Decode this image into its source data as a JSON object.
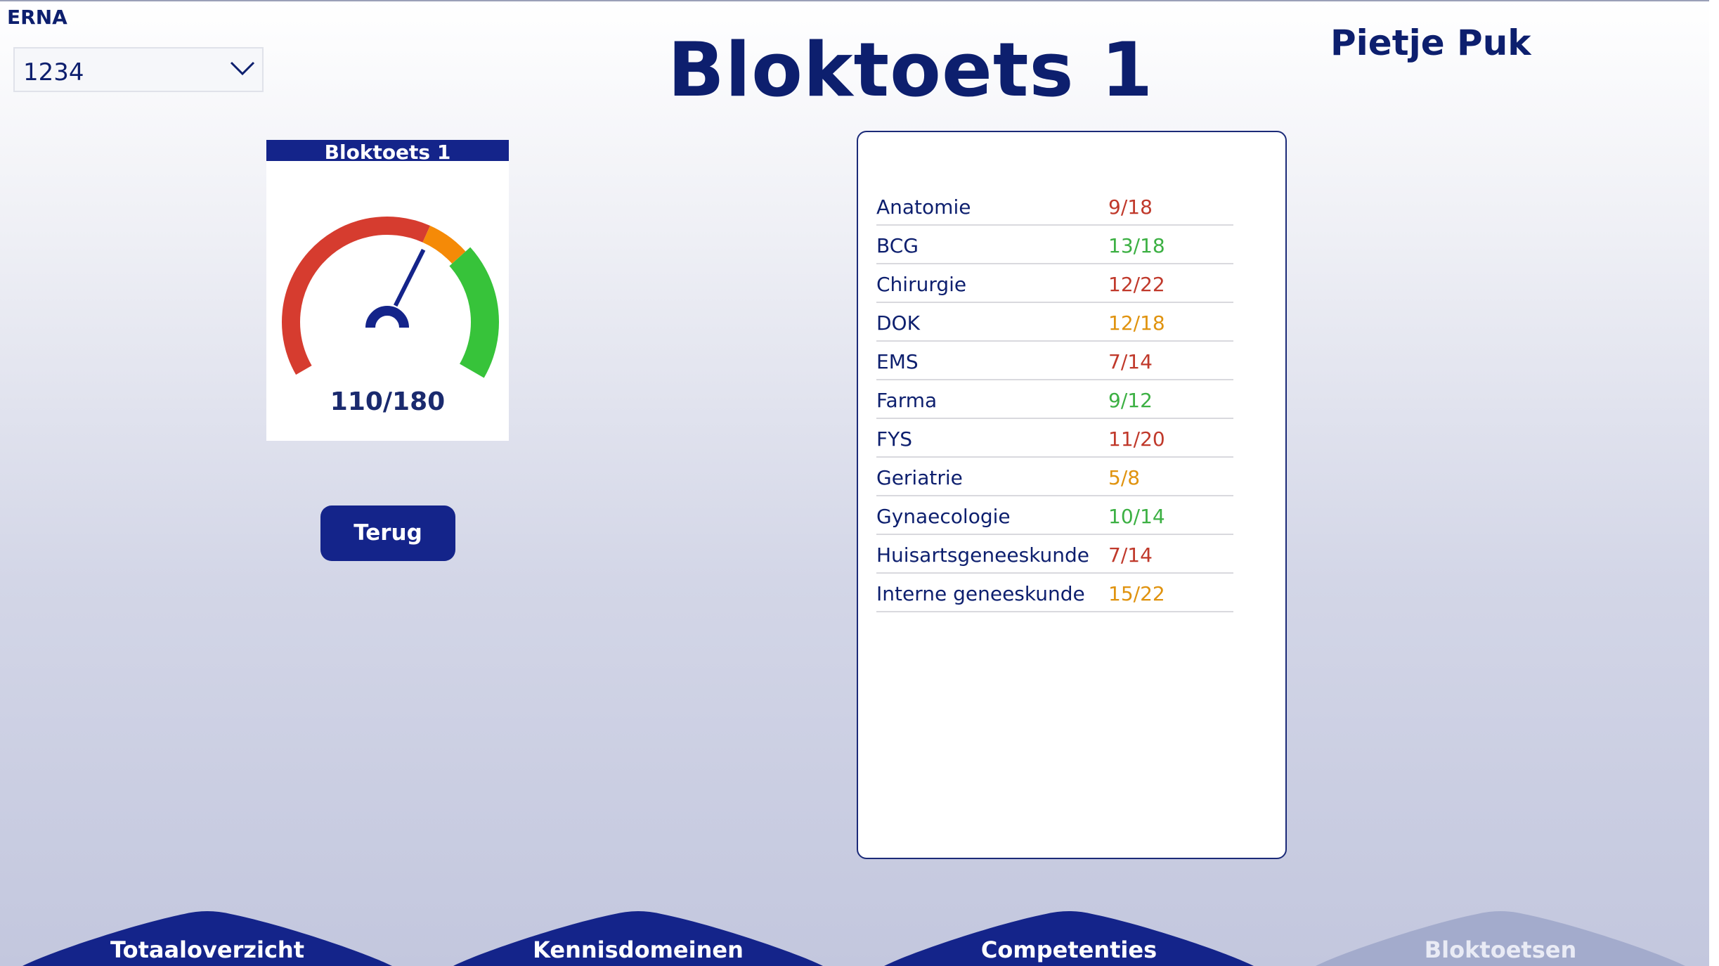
{
  "filter": {
    "label": "ERNA",
    "selected": "1234"
  },
  "page": {
    "title": "Bloktoets 1",
    "user": "Pietje Puk"
  },
  "gauge": {
    "title": "Bloktoets 1",
    "score_label": "110/180",
    "value": 110,
    "max": 180,
    "bands": [
      {
        "from": 0,
        "to": 0.6,
        "color": "#d63c2f"
      },
      {
        "from": 0.6,
        "to": 0.7,
        "color": "#f58a07"
      },
      {
        "from": 0.7,
        "to": 1.0,
        "color": "#37c33a"
      }
    ]
  },
  "buttons": {
    "back": "Terug"
  },
  "results": [
    {
      "subject": "Anatomie",
      "score": "9/18",
      "color": "#c0392b"
    },
    {
      "subject": "BCG",
      "score": "13/18",
      "color": "#3cb043"
    },
    {
      "subject": "Chirurgie",
      "score": "12/22",
      "color": "#c0392b"
    },
    {
      "subject": "DOK",
      "score": "12/18",
      "color": "#e0930f"
    },
    {
      "subject": "EMS",
      "score": "7/14",
      "color": "#c0392b"
    },
    {
      "subject": "Farma",
      "score": "9/12",
      "color": "#3cb043"
    },
    {
      "subject": "FYS",
      "score": "11/20",
      "color": "#c0392b"
    },
    {
      "subject": "Geriatrie",
      "score": "5/8",
      "color": "#e0930f"
    },
    {
      "subject": "Gynaecologie",
      "score": "10/14",
      "color": "#3cb043"
    },
    {
      "subject": "Huisartsgeneeskunde",
      "score": "7/14",
      "color": "#c0392b"
    },
    {
      "subject": "Interne geneeskunde",
      "score": "15/22",
      "color": "#e0930f"
    }
  ],
  "nav": [
    {
      "label": "Totaaloverzicht",
      "active": false,
      "color": "#14248a"
    },
    {
      "label": "Kennisdomeinen",
      "active": false,
      "color": "#14248a"
    },
    {
      "label": "Competenties",
      "active": false,
      "color": "#14248a"
    },
    {
      "label": "Bloktoetsen",
      "active": true,
      "color": "#a3abcc"
    }
  ]
}
